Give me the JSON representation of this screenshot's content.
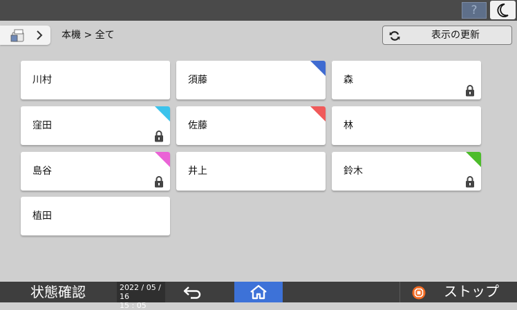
{
  "topbar": {
    "help_label": "?",
    "night_mode_icon": "crescent-moon-icon"
  },
  "header": {
    "device_icon": "device-icon",
    "breadcrumb": "本機 > 全て",
    "refresh_label": "表示の更新"
  },
  "tiles": [
    {
      "name": "川村",
      "corner": null,
      "locked": false
    },
    {
      "name": "須藤",
      "corner": "#3f6bd1",
      "locked": false
    },
    {
      "name": "森",
      "corner": null,
      "locked": true
    },
    {
      "name": "窪田",
      "corner": "#3cc3ec",
      "locked": true
    },
    {
      "name": "佐藤",
      "corner": "#f05a5a",
      "locked": false
    },
    {
      "name": "林",
      "corner": null,
      "locked": false
    },
    {
      "name": "島谷",
      "corner": "#ea63d6",
      "locked": true
    },
    {
      "name": "井上",
      "corner": null,
      "locked": false
    },
    {
      "name": "鈴木",
      "corner": "#4cbc2a",
      "locked": true
    },
    {
      "name": "植田",
      "corner": null,
      "locked": false
    }
  ],
  "footer": {
    "status_label": "状態確認",
    "date": "2022 / 05 / 16",
    "time": "15 : 05",
    "stop_label": "ストップ"
  },
  "colors": {
    "accent_home": "#3d72d8",
    "stop_icon": "#f26a22"
  }
}
